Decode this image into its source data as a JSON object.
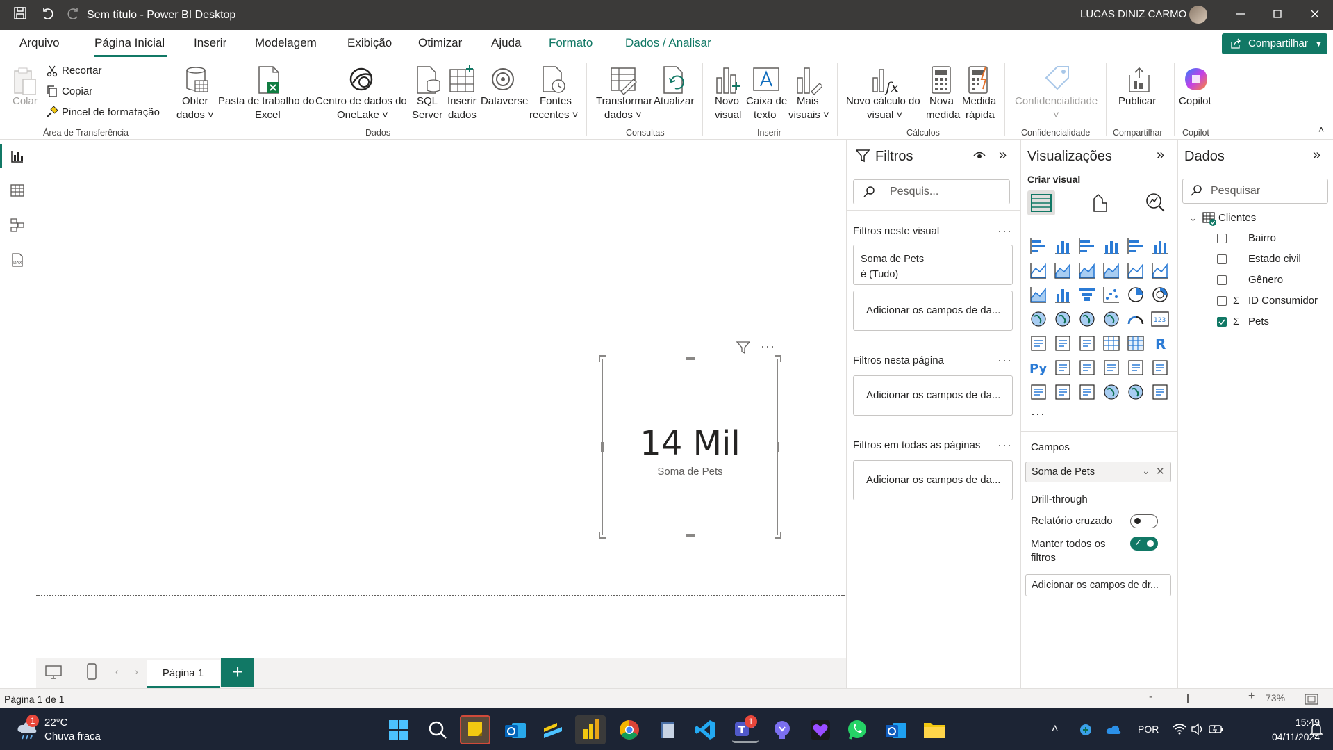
{
  "titlebar": {
    "title": "Sem título - Power BI Desktop",
    "user": "LUCAS DINIZ CARMO"
  },
  "tabs": [
    "Arquivo",
    "Página Inicial",
    "Inserir",
    "Modelagem",
    "Exibição",
    "Otimizar",
    "Ajuda",
    "Formato",
    "Dados / Analisar"
  ],
  "share_label": "Compartilhar",
  "ribbon": {
    "clipboard": {
      "paste": "Colar",
      "cut": "Recortar",
      "copy": "Copiar",
      "format_painter": "Pincel de formatação",
      "group": "Área de Transferência"
    },
    "data": {
      "get_data": [
        "Obter",
        "dados"
      ],
      "excel": [
        "Pasta de trabalho do",
        "Excel"
      ],
      "onelake": [
        "Centro de dados do",
        "OneLake"
      ],
      "sql": [
        "SQL",
        "Server"
      ],
      "enter_data": [
        "Inserir",
        "dados"
      ],
      "dataverse": "Dataverse",
      "recent": [
        "Fontes",
        "recentes"
      ],
      "group": "Dados"
    },
    "queries": {
      "transform": [
        "Transformar",
        "dados"
      ],
      "refresh": "Atualizar",
      "group": "Consultas"
    },
    "insert": {
      "new_visual": [
        "Novo",
        "visual"
      ],
      "text_box": [
        "Caixa de",
        "texto"
      ],
      "more_visuals": [
        "Mais",
        "visuais"
      ],
      "group": "Inserir"
    },
    "calcs": {
      "new_calc": [
        "Novo cálculo do",
        "visual"
      ],
      "new_measure": [
        "Nova",
        "medida"
      ],
      "quick_measure": [
        "Medida",
        "rápida"
      ],
      "group": "Cálculos"
    },
    "sensitivity": {
      "label": "Confidencialidade",
      "group": "Confidencialidade"
    },
    "share": {
      "publish": "Publicar",
      "group": "Compartilhar"
    },
    "copilot": {
      "label": "Copilot",
      "group": "Copilot"
    }
  },
  "card": {
    "value": "14 Mil",
    "label": "Soma de Pets"
  },
  "pages": {
    "tab": "Página 1",
    "add": "+"
  },
  "status": {
    "page_count": "Página 1 de 1",
    "zoom": "73%"
  },
  "filters": {
    "title": "Filtros",
    "search_placeholder": "Pesquis...",
    "visual_section": "Filtros neste visual",
    "filter_card_line1": "Soma de Pets",
    "filter_card_line2": "é (Tudo)",
    "add_fields": "Adicionar os campos de da...",
    "page_section": "Filtros nesta página",
    "all_pages_section": "Filtros em todas as páginas"
  },
  "visualizations": {
    "title": "Visualizações",
    "build": "Criar visual",
    "fields_title": "Campos",
    "field_value": "Soma de Pets",
    "drillthrough": "Drill-through",
    "cross_report": "Relatório cruzado",
    "cross_report_on": false,
    "keep_filters": [
      "Manter todos os",
      "filtros"
    ],
    "keep_filters_on": true,
    "add_drill": "Adicionar os campos de dr...",
    "more": "..."
  },
  "data_pane": {
    "title": "Dados",
    "search_placeholder": "Pesquisar",
    "table": "Clientes",
    "fields": [
      {
        "name": "Bairro",
        "sigma": false,
        "checked": false
      },
      {
        "name": "Estado civil",
        "sigma": false,
        "checked": false
      },
      {
        "name": "Gênero",
        "sigma": false,
        "checked": false
      },
      {
        "name": "ID Consumidor",
        "sigma": true,
        "checked": false
      },
      {
        "name": "Pets",
        "sigma": true,
        "checked": true
      }
    ]
  },
  "taskbar": {
    "temp": "22°C",
    "weather": "Chuva fraca",
    "weather_badge": "1",
    "teams_badge": "1",
    "lang": "POR",
    "time": "15:49",
    "date": "04/11/2024"
  },
  "colors": {
    "accent": "#117865",
    "titlebar": "#3b3a39",
    "taskbar": "#1c2434"
  }
}
